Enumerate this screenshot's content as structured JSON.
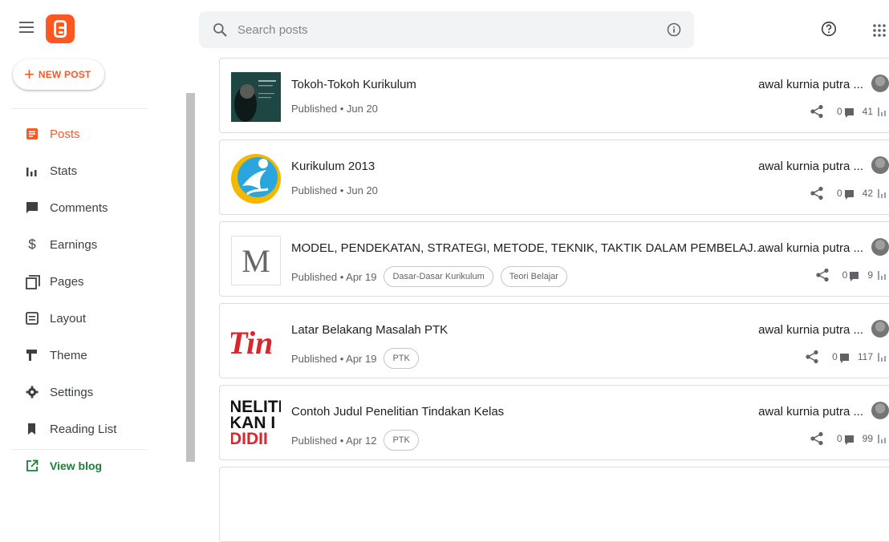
{
  "header": {
    "search_placeholder": "Search posts"
  },
  "sidebar": {
    "new_post_label": "NEW POST",
    "items": [
      {
        "label": "Posts",
        "icon": "posts-icon",
        "active": true
      },
      {
        "label": "Stats",
        "icon": "stats-icon"
      },
      {
        "label": "Comments",
        "icon": "comments-icon"
      },
      {
        "label": "Earnings",
        "icon": "dollar-icon"
      },
      {
        "label": "Pages",
        "icon": "pages-icon"
      },
      {
        "label": "Layout",
        "icon": "layout-icon"
      },
      {
        "label": "Theme",
        "icon": "paint-roller-icon"
      },
      {
        "label": "Settings",
        "icon": "gear-icon"
      },
      {
        "label": "Reading List",
        "icon": "bookmark-icon"
      }
    ],
    "view_blog_label": "View blog"
  },
  "colors": {
    "brand": "#ff5722",
    "view_blog": "#188038"
  },
  "posts": [
    {
      "title": "Tokoh-Tokoh Kurikulum",
      "status": "Published • Jun 20",
      "labels": [],
      "author": "awal kurnia putra ...",
      "comments": "0",
      "views": "41"
    },
    {
      "title": "Kurikulum 2013",
      "status": "Published • Jun 20",
      "labels": [],
      "author": "awal kurnia putra ...",
      "comments": "0",
      "views": "42"
    },
    {
      "title": "MODEL, PENDEKATAN, STRATEGI, METODE, TEKNIK, TAKTIK DALAM PEMBELAJ...",
      "status": "Published • Apr 19",
      "labels": [
        "Dasar-Dasar Kurikulum",
        "Teori Belajar"
      ],
      "author": "awal kurnia putra ...",
      "comments": "0",
      "views": "9",
      "thumb_letter": "M"
    },
    {
      "title": "Latar Belakang Masalah PTK",
      "status": "Published • Apr 19",
      "labels": [
        "PTK"
      ],
      "author": "awal kurnia putra ...",
      "comments": "0",
      "views": "117",
      "thumb_text": "Tin"
    },
    {
      "title": "Contoh Judul Penelitian Tindakan Kelas",
      "status": "Published • Apr 12",
      "labels": [
        "PTK"
      ],
      "author": "awal kurnia putra ...",
      "comments": "0",
      "views": "99",
      "thumb_lines": [
        "NELITI",
        "KAN I",
        "DIDII"
      ]
    }
  ]
}
